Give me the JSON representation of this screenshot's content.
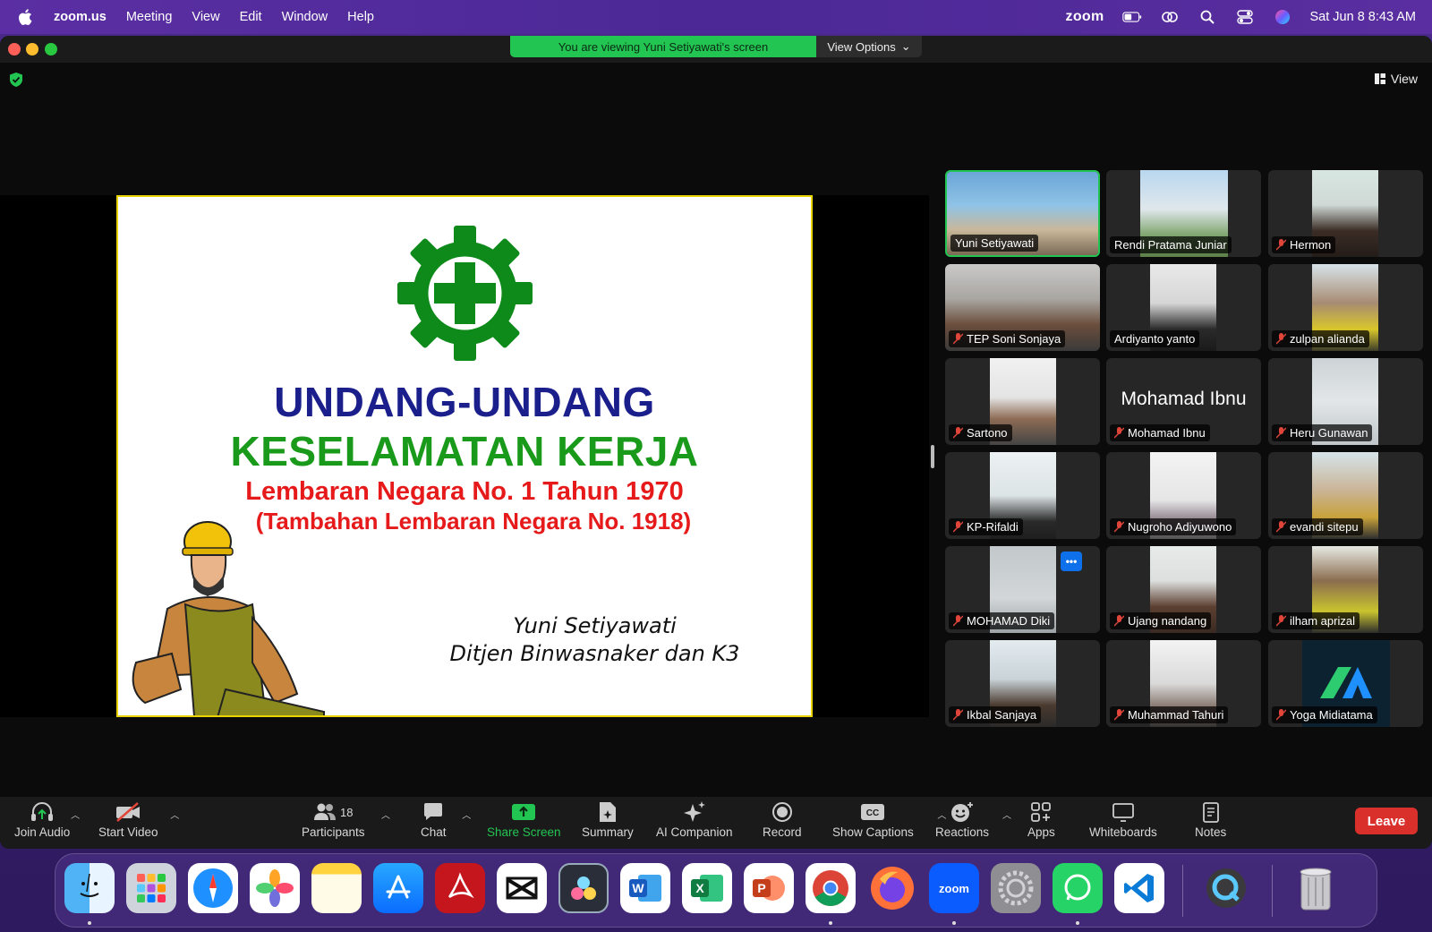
{
  "menubar": {
    "app_name": "zoom.us",
    "menus": [
      "Meeting",
      "View",
      "Edit",
      "Window",
      "Help"
    ],
    "zoom_label": "zoom",
    "datetime": "Sat Jun 8  8:43 AM"
  },
  "window": {
    "share_banner": "You are viewing Yuni Setiyawati's screen",
    "view_options": "View Options",
    "view_label": "View"
  },
  "slide": {
    "title_line1": "UNDANG-UNDANG",
    "title_line2": "KESELAMATAN KERJA",
    "subtitle_line1": "Lembaran Negara No. 1 Tahun 1970",
    "subtitle_line2": "(Tambahan Lembaran Negara No. 1918)",
    "author": "Yuni Setiyawati",
    "organization": "Ditjen Binwasnaker dan K3"
  },
  "participants": [
    {
      "name": "Yuni Setiyawati",
      "muted": false,
      "active": true
    },
    {
      "name": "Rendi Pratama Juniar",
      "muted": false
    },
    {
      "name": "Hermon",
      "muted": true
    },
    {
      "name": "TEP Soni Sonjaya",
      "muted": true
    },
    {
      "name": "Ardiyanto yanto",
      "muted": false
    },
    {
      "name": "zulpan alianda",
      "muted": true
    },
    {
      "name": "Sartono",
      "muted": true
    },
    {
      "name": "Mohamad Ibnu",
      "muted": true,
      "no_video_label": "Mohamad Ibnu"
    },
    {
      "name": "Heru Gunawan",
      "muted": true
    },
    {
      "name": "KP-Rifaldi",
      "muted": true
    },
    {
      "name": "Nugroho Adiyuwono",
      "muted": true
    },
    {
      "name": "evandi sitepu",
      "muted": true
    },
    {
      "name": "MOHAMAD Diki",
      "muted": true,
      "more_button": "•••"
    },
    {
      "name": "Ujang nandang",
      "muted": true
    },
    {
      "name": "ilham aprizal",
      "muted": true
    },
    {
      "name": "Ikbal Sanjaya",
      "muted": true
    },
    {
      "name": "Muhammad Tahuri",
      "muted": true
    },
    {
      "name": "Yoga Midiatama",
      "muted": true
    }
  ],
  "toolbar": {
    "join_audio": "Join Audio",
    "start_video": "Start Video",
    "participants": "Participants",
    "participant_count": "18",
    "chat": "Chat",
    "share_screen": "Share Screen",
    "summary": "Summary",
    "ai_companion": "AI Companion",
    "record": "Record",
    "show_captions": "Show Captions",
    "reactions": "Reactions",
    "apps": "Apps",
    "whiteboards": "Whiteboards",
    "notes": "Notes",
    "leave": "Leave"
  },
  "dock": {
    "apps": [
      "Finder",
      "Launchpad",
      "Safari",
      "Photos",
      "Notes",
      "App Store",
      "Acrobat",
      "CapCut",
      "DaVinci Resolve",
      "Word",
      "Excel",
      "PowerPoint",
      "Chrome",
      "Firefox",
      "Zoom",
      "System Settings",
      "WhatsApp",
      "VS Code",
      "QuickTime",
      "Trash"
    ],
    "zoom_icon_label": "zoom"
  },
  "colors": {
    "accent_green": "#23c552",
    "leave_red": "#d9302c",
    "slide_blue": "#1a1f8c",
    "slide_green": "#1a9a1a",
    "slide_red": "#e61a1a"
  }
}
